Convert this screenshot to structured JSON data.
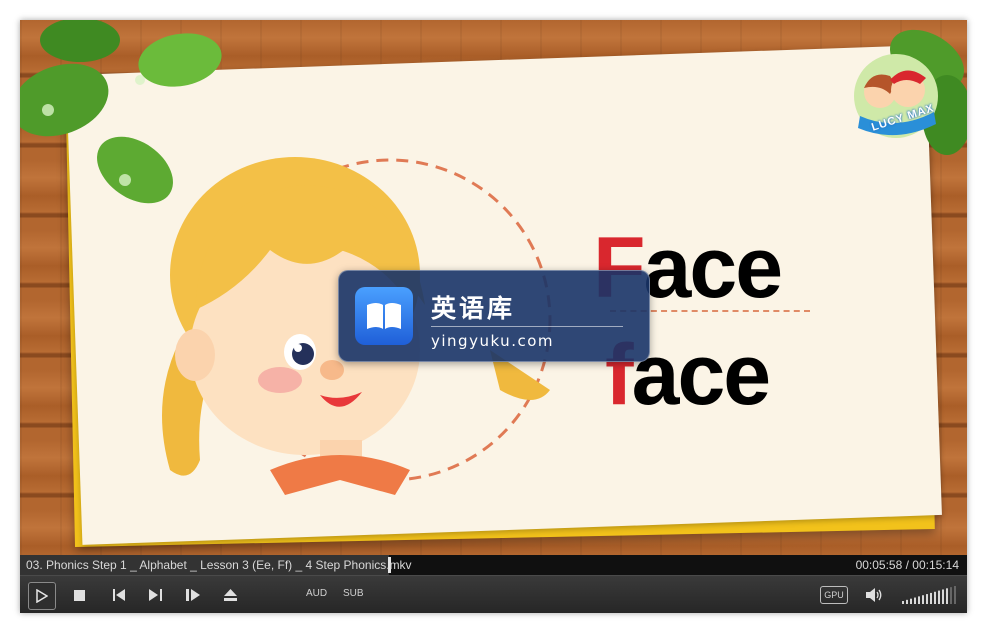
{
  "video": {
    "word_first_line": {
      "first_letter": "F",
      "rest": "ace"
    },
    "word_second_line": {
      "first_letter": "f",
      "rest": "ace"
    },
    "brand_logo_text": "LUCY MAX",
    "watermark": {
      "title": "英语库",
      "domain": "yingyuku.com"
    }
  },
  "info_bar": {
    "filename": "03. Phonics Step 1 _ Alphabet _ Lesson 3 (Ee, Ff) _ 4 Step Phonics.mkv",
    "time": "00:05:58 / 00:15:14",
    "progress": 0.39
  },
  "controls": {
    "play_icon": "play-icon",
    "stop_icon": "stop-icon",
    "prev_icon": "previous-icon",
    "next_icon": "next-icon",
    "frame_step_icon": "frame-step-icon",
    "eject_icon": "eject-icon",
    "audio_label": "AUD",
    "subtitle_label": "SUB",
    "gpu_label": "GPU",
    "speaker_icon": "speaker-icon",
    "volume_level": 0.85
  },
  "colors": {
    "accent_red": "#d9272e",
    "card_bg": "#fbf4e6",
    "card_border": "#f2c21b"
  }
}
